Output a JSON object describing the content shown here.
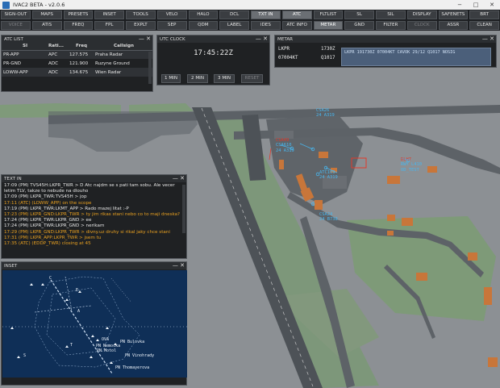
{
  "window": {
    "title": "IVAC2 BETA - v2.0.6",
    "minimize": "−",
    "maximize": "□",
    "close": "✕"
  },
  "toolbar_row1": [
    {
      "label": "SIGN-OUT",
      "state": "normal"
    },
    {
      "label": "MAPS",
      "state": "normal"
    },
    {
      "label": "PRESETS",
      "state": "normal"
    },
    {
      "label": "INSET",
      "state": "normal"
    },
    {
      "label": "TOOLS",
      "state": "normal"
    },
    {
      "label": "VELO",
      "state": "normal"
    },
    {
      "label": "HALO",
      "state": "normal"
    },
    {
      "label": "DCL",
      "state": "normal"
    },
    {
      "label": "TXT IN",
      "state": "active"
    },
    {
      "label": "ATC",
      "state": "active"
    },
    {
      "label": "FLTLIST",
      "state": "normal"
    },
    {
      "label": "SL",
      "state": "normal"
    },
    {
      "label": "SIL",
      "state": "normal"
    },
    {
      "label": "DISPLAY",
      "state": "normal"
    },
    {
      "label": "SAFENETS",
      "state": "normal"
    },
    {
      "label": "BRT",
      "state": "normal"
    }
  ],
  "toolbar_row2": [
    {
      "label": "VOICE",
      "state": "dim"
    },
    {
      "label": "ATIS",
      "state": "normal"
    },
    {
      "label": "FREQ",
      "state": "normal"
    },
    {
      "label": "FPL",
      "state": "normal"
    },
    {
      "label": "EXPLT",
      "state": "normal"
    },
    {
      "label": "SEP",
      "state": "normal"
    },
    {
      "label": "QDM",
      "state": "normal"
    },
    {
      "label": "LABEL",
      "state": "normal"
    },
    {
      "label": "IDES",
      "state": "normal"
    },
    {
      "label": "ATC INFO",
      "state": "normal"
    },
    {
      "label": "METAR",
      "state": "active"
    },
    {
      "label": "GND",
      "state": "normal"
    },
    {
      "label": "FILTER",
      "state": "normal"
    },
    {
      "label": "CLOCK",
      "state": "dim"
    },
    {
      "label": "ASSR",
      "state": "normal"
    },
    {
      "label": "CLEAN",
      "state": "normal"
    }
  ],
  "atc_list": {
    "title": "ATC LIST",
    "columns": [
      "SI",
      "Rati...",
      "Freq",
      "Callsign"
    ],
    "rows": [
      {
        "si": "PR-APP",
        "rating": "APC",
        "freq": "127.575",
        "callsign": "Praha Radar"
      },
      {
        "si": "PR-GND",
        "rating": "ADC",
        "freq": "121.900",
        "callsign": "Ruzyne Ground"
      },
      {
        "si": "LOWW-APP",
        "rating": "ADC",
        "freq": "134.675",
        "callsign": "Wien Radar"
      }
    ]
  },
  "utc_clock": {
    "title": "UTC CLOCK",
    "time": "17:45:22Z",
    "buttons": [
      "1 MIN",
      "2 MIN",
      "3 MIN",
      "RESET"
    ]
  },
  "metar": {
    "title": "METAR",
    "rows": [
      {
        "station": "LKPR",
        "time": "1730Z"
      },
      {
        "station": "07004KT",
        "time": "Q1017"
      }
    ],
    "text": "LKPR 191730Z 07004KT CAVOK 29/12 Q1017 NOSIG"
  },
  "text_in": {
    "title": "TEXT IN",
    "lines": [
      {
        "text": "17:09 (PM) TVS45H:LKPR_TWR > D Atc najdm se s pati tam sobu. Ale vecer",
        "color": "white"
      },
      {
        "text": "letim TLV, takze to nebude na dlouho",
        "color": "white"
      },
      {
        "text": "17:09 (PM) LKPR_TWR:TVS45H > jop",
        "color": "white"
      },
      {
        "text": "17:11 (ATC) (LOWW_APP) on the scope",
        "color": "orange"
      },
      {
        "text": "17:19 (PM) LKPR_TWR:LKMT_APP > Rado mazej litat :-P",
        "color": "white"
      },
      {
        "text": "17:23 (PM) LKPR_GND:LKPR_TWR > ty jim rikas stani nebo co to maji dneska?",
        "color": "orange"
      },
      {
        "text": "17:24 (PM) LKPR_TWR:LKPR_GND > ee",
        "color": "white"
      },
      {
        "text": "17:24 (PM) LKPR_TWR:LKPR_GND > nerikam",
        "color": "white"
      },
      {
        "text": "17:29 (PM) LKPR_GND:LKPR_TWR > divny.uz druhy si rikal jaky chce stani",
        "color": "orange"
      },
      {
        "text": "17:31 (PM) LKPR_APP:LKPR_TWR > jsem tu",
        "color": "orange"
      },
      {
        "text": "17:35 (ATC) (EDDP_TWR) closing at 45",
        "color": "orange"
      }
    ]
  },
  "inset": {
    "title": "INSET",
    "labels": [
      "OVA",
      "PN Bulovka",
      "PN Nemocka",
      "PN Motol",
      "PN Vinohrady",
      "PN Thomayerova",
      "C",
      "S",
      "T",
      "A",
      "E"
    ]
  },
  "radar_labels": [
    {
      "lines": [
        "CSA26",
        "24 A319"
      ],
      "color": "blue"
    },
    {
      "lines": [
        "CSA49",
        "CSA610",
        "24 A319"
      ],
      "color": "blue"
    },
    {
      "lines": [
        "ATC109",
        "24 A319"
      ],
      "color": "blue"
    },
    {
      "lines": [
        "DLH7",
        "RWY L410",
        "OD_TEST"
      ],
      "color": "blue"
    },
    {
      "lines": [
        "CSA24",
        "24 B738"
      ],
      "color": "blue"
    }
  ],
  "colors": {
    "radar_blue": "#48b6ee",
    "alert_red": "#e23a2a",
    "stand_orange": "#c8763a",
    "text_orange": "#e8a020",
    "inset_bg": "#0f2f57"
  }
}
